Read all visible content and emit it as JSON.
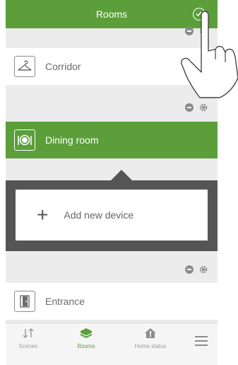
{
  "header": {
    "title": "Rooms",
    "confirm_icon": "check-circle-icon"
  },
  "rooms": [
    {
      "label": "Corridor",
      "icon": "hanger-icon"
    },
    {
      "label": "Dining room",
      "icon": "plate-cutlery-icon"
    },
    {
      "label": "Entrance",
      "icon": "door-icon"
    }
  ],
  "add_device": {
    "label": "Add new device"
  },
  "bottom_nav": [
    {
      "label": "Scenes"
    },
    {
      "label": "Rooms"
    },
    {
      "label": "Home status"
    }
  ],
  "colors": {
    "accent": "#5b9e3a",
    "panel": "#555555",
    "background": "#ececec"
  }
}
